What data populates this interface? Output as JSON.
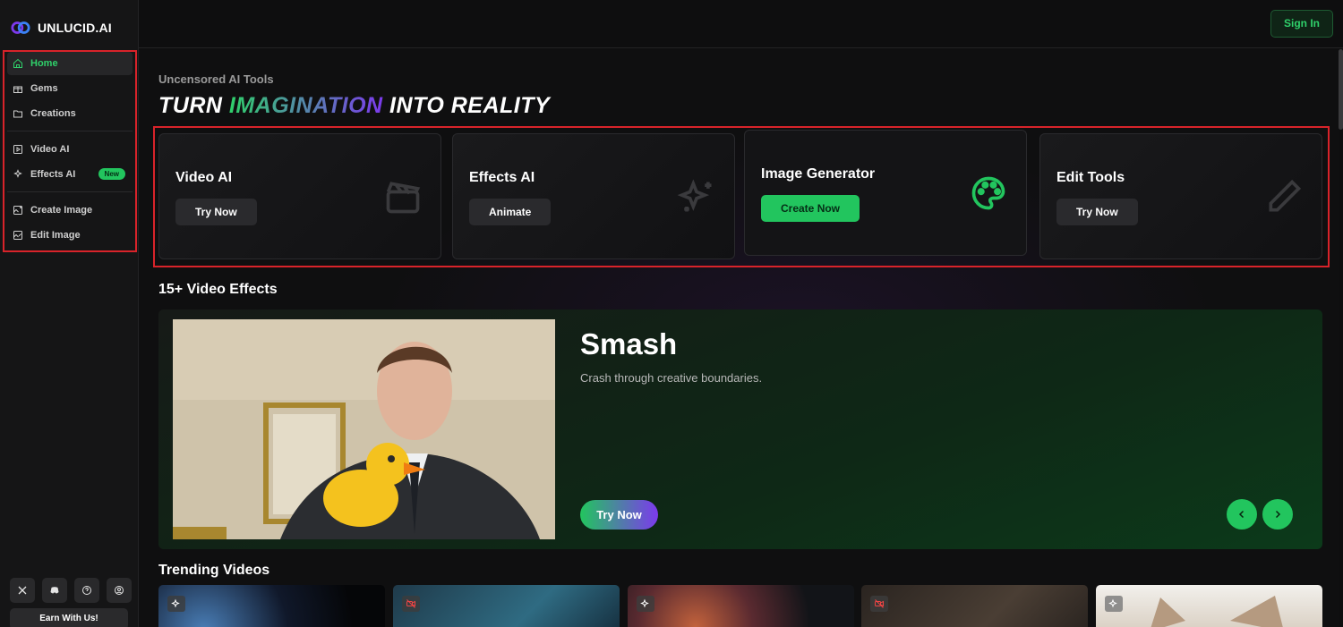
{
  "brand": {
    "name": "UNLUCID.AI"
  },
  "sidebar": {
    "items": [
      {
        "label": "Home",
        "icon": "home-icon",
        "active": true
      },
      {
        "label": "Gems",
        "icon": "gift-icon"
      },
      {
        "label": "Creations",
        "icon": "folder-icon"
      },
      {
        "label": "Video AI",
        "icon": "video-icon"
      },
      {
        "label": "Effects AI",
        "icon": "sparkles-icon",
        "badge": "New"
      },
      {
        "label": "Create Image",
        "icon": "image-plus-icon"
      },
      {
        "label": "Edit Image",
        "icon": "image-edit-icon"
      }
    ],
    "social": [
      "x-icon",
      "discord-icon",
      "help-icon",
      "user-circle-icon"
    ],
    "earn_label": "Earn With Us!"
  },
  "header": {
    "signin_label": "Sign In"
  },
  "hero": {
    "subtitle": "Uncensored AI Tools",
    "title_part1": "TURN ",
    "title_highlight": "IMAGINATION",
    "title_part2": " INTO REALITY"
  },
  "tools": [
    {
      "title": "Video AI",
      "button": "Try Now",
      "icon": "clapperboard-icon"
    },
    {
      "title": "Effects AI",
      "button": "Animate",
      "icon": "sparkles-icon"
    },
    {
      "title": "Image Generator",
      "button": "Create Now",
      "icon": "palette-icon"
    },
    {
      "title": "Edit Tools",
      "button": "Try Now",
      "icon": "pencil-icon"
    }
  ],
  "effects": {
    "section_title": "15+ Video Effects",
    "current": {
      "name": "Smash",
      "description": "Crash through creative boundaries.",
      "button": "Try Now"
    }
  },
  "trending": {
    "section_title": "Trending Videos"
  },
  "colors": {
    "accent": "#22c55e",
    "brand_purple": "#7c3aed",
    "highlight_box": "#d8232a"
  }
}
